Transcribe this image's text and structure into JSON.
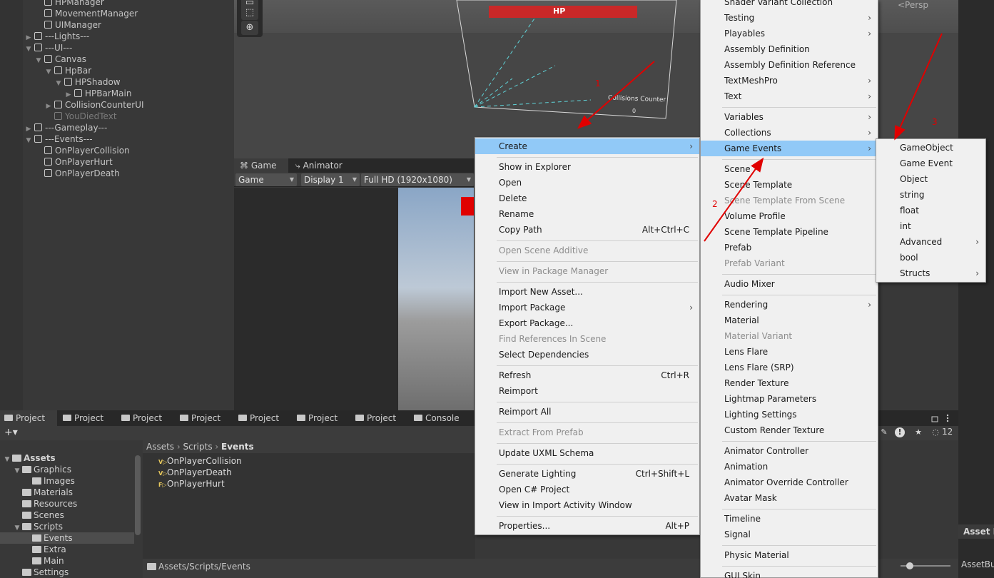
{
  "hierarchy": {
    "rows": [
      {
        "label": "HPManager",
        "level": 2,
        "fold": ""
      },
      {
        "label": "MovementManager",
        "level": 2,
        "fold": ""
      },
      {
        "label": "UIManager",
        "level": 2,
        "fold": ""
      },
      {
        "label": "---Lights---",
        "level": 1,
        "fold": "▶"
      },
      {
        "label": "---UI---",
        "level": 1,
        "fold": "▼"
      },
      {
        "label": "Canvas",
        "level": 2,
        "fold": "▼"
      },
      {
        "label": "HpBar",
        "level": 3,
        "fold": "▼"
      },
      {
        "label": "HPShadow",
        "level": 4,
        "fold": "▼"
      },
      {
        "label": "HPBarMain",
        "level": 5,
        "fold": "▶"
      },
      {
        "label": "CollisionCounterUI",
        "level": 3,
        "fold": "▶"
      },
      {
        "label": "YouDiedText",
        "level": 3,
        "fold": "",
        "dim": true
      },
      {
        "label": "---Gameplay---",
        "level": 1,
        "fold": "▶"
      },
      {
        "label": "---Events---",
        "level": 1,
        "fold": "▼"
      },
      {
        "label": "OnPlayerCollision",
        "level": 2,
        "fold": ""
      },
      {
        "label": "OnPlayerHurt",
        "level": 2,
        "fold": ""
      },
      {
        "label": "OnPlayerDeath",
        "level": 2,
        "fold": ""
      }
    ]
  },
  "scene": {
    "hp_label": "HP",
    "persp_label": "<Persp",
    "collision_counter_label": "Collisions Counter",
    "collision_counter_value": "0",
    "annotation_1": "1",
    "annotation_2": "2",
    "annotation_3": "3"
  },
  "game": {
    "tabs": [
      {
        "label": "Game",
        "icon": "gamepad-icon"
      },
      {
        "label": "Animator",
        "icon": "animator-icon"
      }
    ],
    "mode": "Game",
    "display": "Display 1",
    "resolution": "Full HD (1920x1080)"
  },
  "project": {
    "tabs": [
      "Project",
      "Project",
      "Project",
      "Project",
      "Project",
      "Project",
      "Project",
      "Console"
    ],
    "add_label": "+▾",
    "tree": [
      {
        "label": "Assets",
        "level": 0,
        "fold": "▼",
        "bold": true
      },
      {
        "label": "Graphics",
        "level": 1,
        "fold": "▼"
      },
      {
        "label": "Images",
        "level": 2,
        "fold": ""
      },
      {
        "label": "Materials",
        "level": 1,
        "fold": ""
      },
      {
        "label": "Resources",
        "level": 1,
        "fold": ""
      },
      {
        "label": "Scenes",
        "level": 1,
        "fold": ""
      },
      {
        "label": "Scripts",
        "level": 1,
        "fold": "▼"
      },
      {
        "label": "Events",
        "level": 2,
        "fold": "",
        "selected": true
      },
      {
        "label": "Extra",
        "level": 2,
        "fold": ""
      },
      {
        "label": "Main",
        "level": 2,
        "fold": ""
      },
      {
        "label": "Settings",
        "level": 1,
        "fold": ""
      }
    ],
    "breadcrumb": [
      "Assets",
      "Scripts",
      "Events"
    ],
    "files": [
      {
        "tag": "V▷",
        "label": "OnPlayerCollision"
      },
      {
        "tag": "V▷",
        "label": "OnPlayerDeath"
      },
      {
        "tag": "F▷",
        "label": "OnPlayerHurt"
      }
    ],
    "footer_path": "Assets/Scripts/Events",
    "hidden_count": "12"
  },
  "inspector": {
    "tab_label": "Asset L",
    "value": "AssetBu"
  },
  "menu_main": {
    "items": [
      {
        "label": "Create",
        "sub": true,
        "hl": true
      },
      {
        "sep": true
      },
      {
        "label": "Show in Explorer"
      },
      {
        "label": "Open"
      },
      {
        "label": "Delete"
      },
      {
        "label": "Rename"
      },
      {
        "label": "Copy Path",
        "shortcut": "Alt+Ctrl+C"
      },
      {
        "sep": true
      },
      {
        "label": "Open Scene Additive",
        "dis": true
      },
      {
        "sep": true
      },
      {
        "label": "View in Package Manager",
        "dis": true
      },
      {
        "sep": true
      },
      {
        "label": "Import New Asset..."
      },
      {
        "label": "Import Package",
        "sub": true
      },
      {
        "label": "Export Package..."
      },
      {
        "label": "Find References In Scene",
        "dis": true
      },
      {
        "label": "Select Dependencies"
      },
      {
        "sep": true
      },
      {
        "label": "Refresh",
        "shortcut": "Ctrl+R"
      },
      {
        "label": "Reimport"
      },
      {
        "sep": true
      },
      {
        "label": "Reimport All"
      },
      {
        "sep": true
      },
      {
        "label": "Extract From Prefab",
        "dis": true
      },
      {
        "sep": true
      },
      {
        "label": "Update UXML Schema"
      },
      {
        "sep": true
      },
      {
        "label": "Generate Lighting",
        "shortcut": "Ctrl+Shift+L"
      },
      {
        "label": "Open C# Project"
      },
      {
        "label": "View in Import Activity Window"
      },
      {
        "sep": true
      },
      {
        "label": "Properties...",
        "shortcut": "Alt+P"
      }
    ]
  },
  "menu_create": {
    "items": [
      {
        "label": "Shader Variant Collection"
      },
      {
        "label": "Testing",
        "sub": true
      },
      {
        "label": "Playables",
        "sub": true
      },
      {
        "label": "Assembly Definition"
      },
      {
        "label": "Assembly Definition Reference"
      },
      {
        "label": "TextMeshPro",
        "sub": true
      },
      {
        "label": "Text",
        "sub": true
      },
      {
        "sep": true
      },
      {
        "label": "Variables",
        "sub": true
      },
      {
        "label": "Collections",
        "sub": true
      },
      {
        "label": "Game Events",
        "sub": true,
        "hl": true
      },
      {
        "sep": true
      },
      {
        "label": "Scene"
      },
      {
        "label": "Scene Template"
      },
      {
        "label": "Scene Template From Scene",
        "dis": true
      },
      {
        "label": "Volume Profile"
      },
      {
        "label": "Scene Template Pipeline"
      },
      {
        "label": "Prefab"
      },
      {
        "label": "Prefab Variant",
        "dis": true
      },
      {
        "sep": true
      },
      {
        "label": "Audio Mixer"
      },
      {
        "sep": true
      },
      {
        "label": "Rendering",
        "sub": true
      },
      {
        "label": "Material"
      },
      {
        "label": "Material Variant",
        "dis": true
      },
      {
        "label": "Lens Flare"
      },
      {
        "label": "Lens Flare (SRP)"
      },
      {
        "label": "Render Texture"
      },
      {
        "label": "Lightmap Parameters"
      },
      {
        "label": "Lighting Settings"
      },
      {
        "label": "Custom Render Texture"
      },
      {
        "sep": true
      },
      {
        "label": "Animator Controller"
      },
      {
        "label": "Animation"
      },
      {
        "label": "Animator Override Controller"
      },
      {
        "label": "Avatar Mask"
      },
      {
        "sep": true
      },
      {
        "label": "Timeline"
      },
      {
        "label": "Signal"
      },
      {
        "sep": true
      },
      {
        "label": "Physic Material"
      },
      {
        "sep": true
      },
      {
        "label": "GUI Skin"
      }
    ]
  },
  "menu_events": {
    "items": [
      {
        "label": "GameObject"
      },
      {
        "label": "Game Event"
      },
      {
        "label": "Object"
      },
      {
        "label": "string"
      },
      {
        "label": "float"
      },
      {
        "label": "int"
      },
      {
        "label": "Advanced",
        "sub": true
      },
      {
        "label": "bool"
      },
      {
        "label": "Structs",
        "sub": true
      }
    ]
  },
  "colors": {
    "highlight": "#91c9f7",
    "annotation_red": "#e00000",
    "hp_red": "#c92828"
  }
}
